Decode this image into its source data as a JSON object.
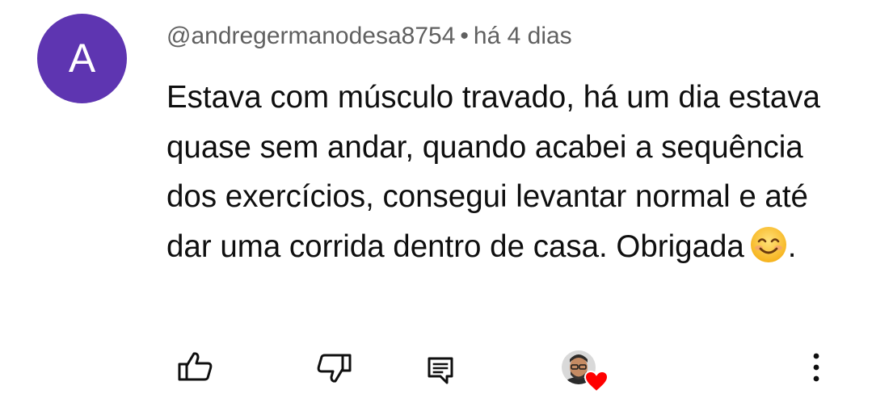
{
  "comment": {
    "avatar_letter": "A",
    "avatar_color": "#5e35b1",
    "username": "@andregermanodesa8754",
    "separator": "•",
    "time_ago": "há 4 dias",
    "text": "Estava com músculo travado, há um dia estava quase sem andar, quando acabei a sequência dos exercícios, consegui levantar normal e até dar uma corrida dentro de casa. Obrigada",
    "text_end": ".",
    "emoji": "smiling-face-emoji"
  },
  "actions": {
    "icons": [
      "thumbs-up-icon",
      "thumbs-down-icon",
      "reply-icon",
      "creator-heart-icon",
      "more-vert-icon"
    ],
    "heart_color": "#ff0000"
  }
}
